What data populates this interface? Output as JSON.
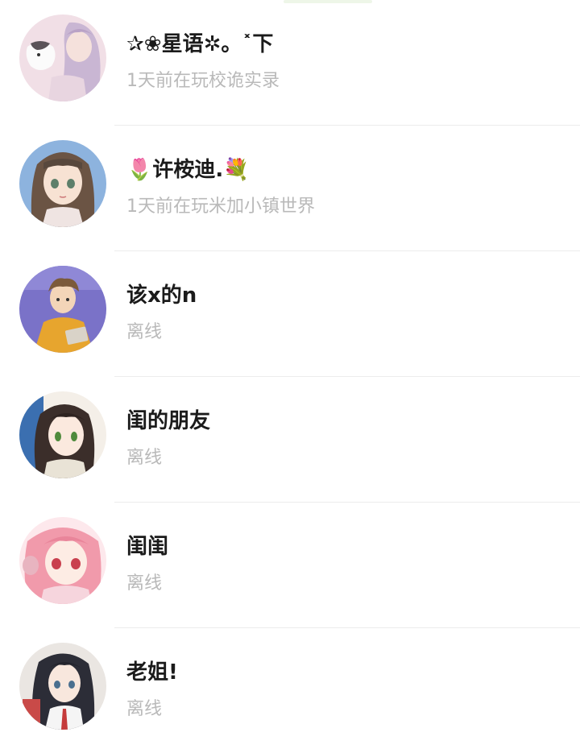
{
  "friends": [
    {
      "name": "✰❀星语✲。˟下",
      "status": "1天前在玩校诡实录",
      "avatar": "anime-girl-lavender-avatar"
    },
    {
      "name": "🌷许桉迪.💐",
      "status": "1天前在玩米加小镇世界",
      "avatar": "anime-girl-brown-hair-avatar"
    },
    {
      "name": "该x的n",
      "status": "离线",
      "avatar": "anime-boy-yellow-hoodie-avatar"
    },
    {
      "name": "闺的朋友",
      "status": "离线",
      "avatar": "anime-girl-dark-hair-avatar"
    },
    {
      "name": "闺闺",
      "status": "离线",
      "avatar": "anime-girl-pink-hair-avatar"
    },
    {
      "name": "老姐!",
      "status": "离线",
      "avatar": "anime-girl-black-hair-avatar"
    }
  ]
}
